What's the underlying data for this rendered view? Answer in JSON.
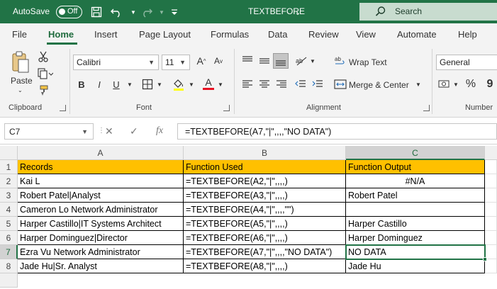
{
  "titlebar": {
    "autosave_label": "AutoSave",
    "autosave_state": "Off",
    "document_title": "TEXTBEFORE",
    "search_placeholder": "Search"
  },
  "ribbon_tabs": [
    "File",
    "Home",
    "Insert",
    "Page Layout",
    "Formulas",
    "Data",
    "Review",
    "View",
    "Automate",
    "Help"
  ],
  "active_tab": "Home",
  "ribbon": {
    "clipboard": {
      "paste_label": "Paste",
      "group_label": "Clipboard"
    },
    "font": {
      "font_name": "Calibri",
      "font_size": "11",
      "group_label": "Font",
      "bold": "B",
      "italic": "I",
      "underline": "U",
      "grow": "A",
      "shrink": "A",
      "font_color": "A",
      "font_color_hex": "#e81123"
    },
    "alignment": {
      "wrap_text": "Wrap Text",
      "merge_center": "Merge & Center",
      "group_label": "Alignment"
    },
    "number": {
      "format": "General",
      "group_label": "Number",
      "percent": "%",
      "comma": "9"
    }
  },
  "formula_bar": {
    "name_box": "C7",
    "cancel": "✕",
    "enter": "✓",
    "fx": "fx",
    "formula": "=TEXTBEFORE(A7,\"|\",,,,\"NO DATA\")"
  },
  "sheet": {
    "columns": [
      "A",
      "B",
      "C"
    ],
    "active_column": "C",
    "active_row": "7",
    "rows": [
      {
        "num": "1",
        "a": "Records",
        "b": "Function Used",
        "c": "Function Output"
      },
      {
        "num": "2",
        "a": "Kai L",
        "b": "=TEXTBEFORE(A2,\"|\",,,,)",
        "c": "#N/A"
      },
      {
        "num": "3",
        "a": "Robert Patel|Analyst",
        "b": "=TEXTBEFORE(A3,\"|\",,,,)",
        "c": "Robert Patel"
      },
      {
        "num": "4",
        "a": "Cameron Lo Network Administrator",
        "b": "=TEXTBEFORE(A4,\"|\",,,,\"\")",
        "c": ""
      },
      {
        "num": "5",
        "a": "Harper Castillo|IT Systems Architect",
        "b": "=TEXTBEFORE(A5,\"|\",,,,)",
        "c": "Harper Castillo"
      },
      {
        "num": "6",
        "a": "Harper Dominguez|Director",
        "b": "=TEXTBEFORE(A6,\"|\",,,,)",
        "c": "Harper Dominguez"
      },
      {
        "num": "7",
        "a": "Ezra Vu Network Administrator",
        "b": "=TEXTBEFORE(A7,\"|\",,,,\"NO DATA\")",
        "c": "NO DATA"
      },
      {
        "num": "8",
        "a": "Jade Hu|Sr. Analyst",
        "b": "=TEXTBEFORE(A8,\"|\",,,,)",
        "c": "Jade Hu"
      }
    ],
    "header_fill": "#ffc000",
    "accent": "#217346"
  }
}
